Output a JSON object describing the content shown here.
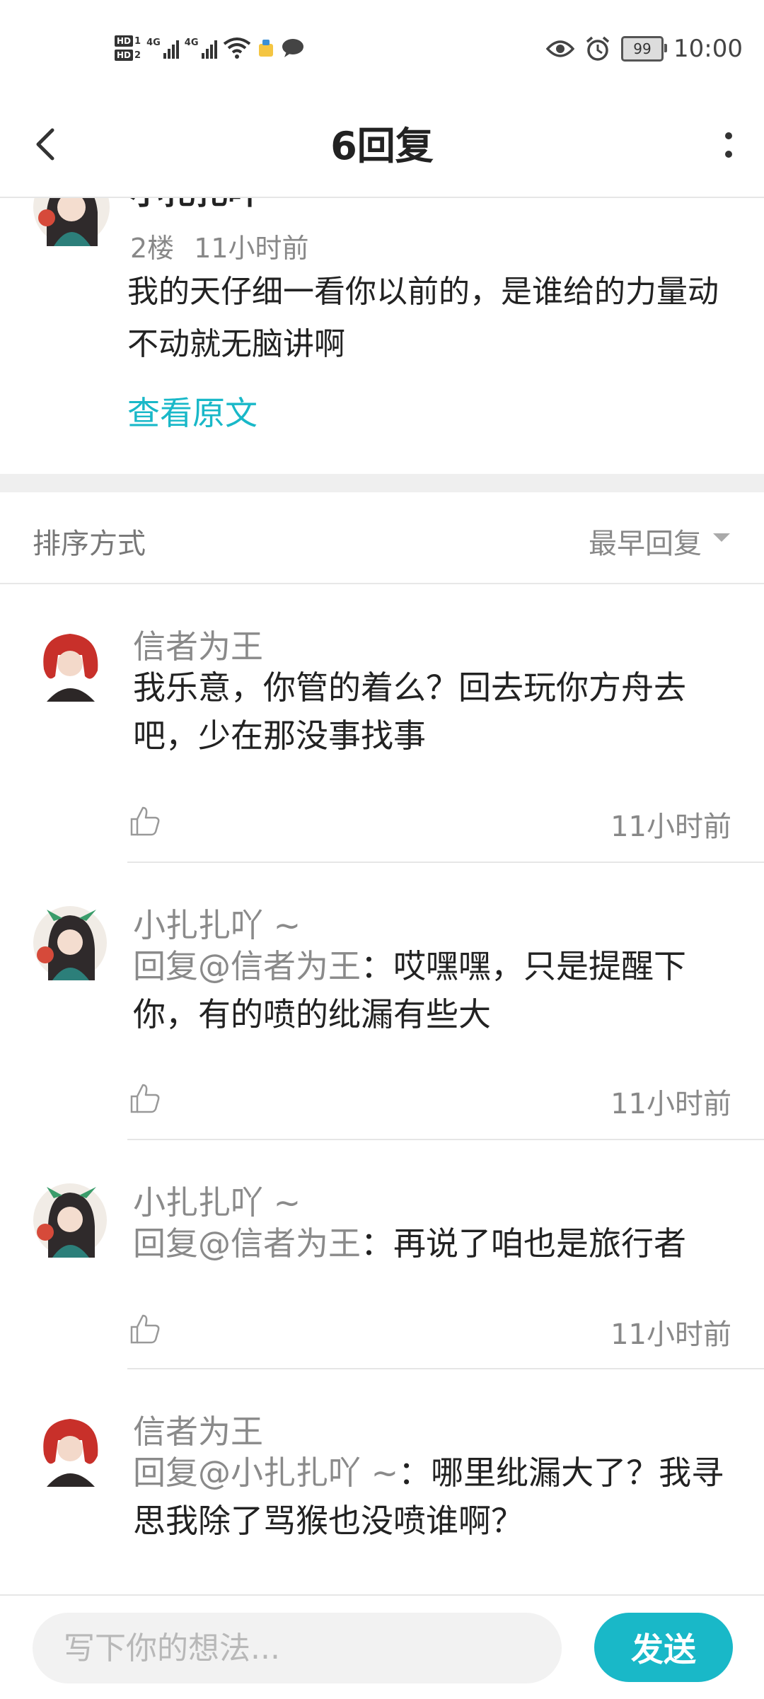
{
  "status_bar": {
    "hd1": "HD",
    "sim1": "1",
    "hd2": "HD",
    "sim2": "2",
    "net1": "4G",
    "net2": "4G",
    "battery": "99",
    "time": "10:00",
    "icons": [
      "signal-icon",
      "wifi-icon",
      "app-notification-icon",
      "chat-bubble-icon",
      "eye-icon",
      "alarm-icon",
      "battery-icon"
    ]
  },
  "header": {
    "title": "6回复"
  },
  "original_post": {
    "author": "小扎扎吖 ~",
    "floor": "2楼",
    "time": "11小时前",
    "text": "我的天仔细一看你以前的，是谁给的力量动不动就无脑讲啊",
    "view_original": "查看原文"
  },
  "sort": {
    "label": "排序方式",
    "value": "最早回复"
  },
  "replies": [
    {
      "name": "信者为王",
      "reply_to": "",
      "text": "我乐意，你管的着么？回去玩你方舟去吧，少在那没事找事",
      "time": "11小时前",
      "avatar": "red"
    },
    {
      "name": "小扎扎吖 ~",
      "reply_to": "回复@信者为王",
      "text": "：哎嘿嘿，只是提醒下你，有的喷的纰漏有些大",
      "time": "11小时前",
      "avatar": "green"
    },
    {
      "name": "小扎扎吖 ~",
      "reply_to": "回复@信者为王",
      "text": "：再说了咱也是旅行者",
      "time": "11小时前",
      "avatar": "green"
    },
    {
      "name": "信者为王",
      "reply_to": "回复@小扎扎吖 ~",
      "text": "：哪里纰漏大了？我寻思我除了骂猴也没喷谁啊？",
      "time": "",
      "avatar": "red"
    }
  ],
  "composer": {
    "placeholder": "写下你的想法...",
    "send_label": "发送"
  },
  "colors": {
    "accent": "#19b8c8",
    "muted_text": "#8a8a8a",
    "divider": "#efefef"
  }
}
